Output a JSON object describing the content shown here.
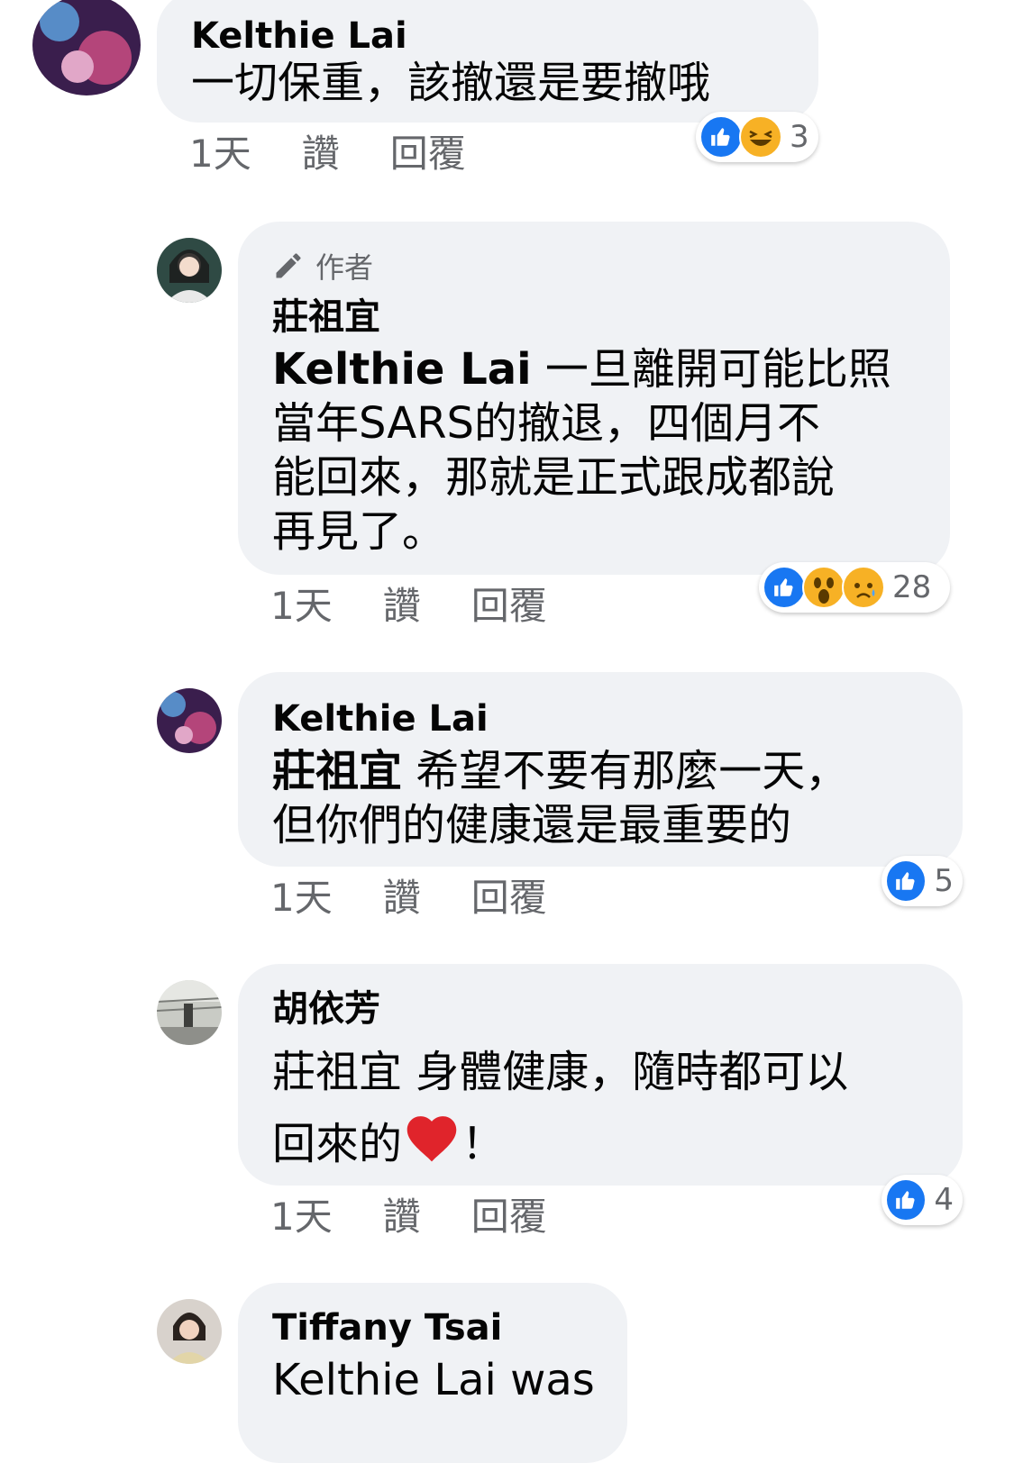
{
  "comments": [
    {
      "name": "Kelthie Lai",
      "text": "一切保重，該撤還是要撤哦",
      "time": "1天",
      "like_label": "讚",
      "reply_label": "回覆",
      "reactions": [
        "like-icon",
        "haha-icon"
      ],
      "reaction_count": "3"
    },
    {
      "author_badge": "作者",
      "name": "莊祖宜",
      "mention": "Kelthie Lai",
      "text_lines": [
        " 一旦離開可能比照",
        "當年SARS的撤退，四個月不",
        "能回來，那就是正式跟成都說",
        "再見了。"
      ],
      "time": "1天",
      "like_label": "讚",
      "reply_label": "回覆",
      "reactions": [
        "like-icon",
        "wow-icon",
        "sad-icon"
      ],
      "reaction_count": "28"
    },
    {
      "name": "Kelthie Lai",
      "mention": "莊祖宜",
      "text_lines": [
        " 希望不要有那麼一天，",
        "但你們的健康還是最重要的"
      ],
      "time": "1天",
      "like_label": "讚",
      "reply_label": "回覆",
      "reactions": [
        "like-icon"
      ],
      "reaction_count": "5"
    },
    {
      "name": "胡依芳",
      "text_line1": "莊祖宜 身體健康，隨時都可以",
      "text_line2_a": "回來的",
      "text_line2_b": "！",
      "time": "1天",
      "like_label": "讚",
      "reply_label": "回覆",
      "reactions": [
        "like-icon"
      ],
      "reaction_count": "4"
    },
    {
      "name": "Tiffany Tsai",
      "text": "Kelthie Lai was"
    }
  ],
  "colors": {
    "bubble": "#f0f2f5",
    "meta": "#65676b",
    "like": "#1877f2",
    "emoji": "#f7b125"
  }
}
